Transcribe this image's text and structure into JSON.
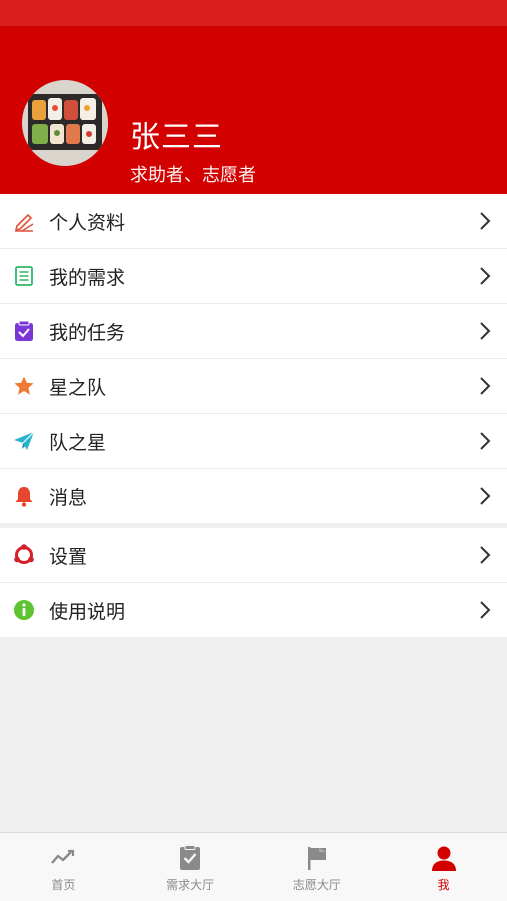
{
  "profile": {
    "name": "张三三",
    "roles": "求助者、志愿者"
  },
  "menu": {
    "items": [
      {
        "label": "个人资料",
        "icon": "pencil-icon",
        "color": "#e0523c"
      },
      {
        "label": "我的需求",
        "icon": "list-icon",
        "color": "#2fb86b"
      },
      {
        "label": "我的任务",
        "icon": "task-check-icon",
        "color": "#7b35d6"
      },
      {
        "label": "星之队",
        "icon": "star-icon",
        "color": "#f07a35"
      },
      {
        "label": "队之星",
        "icon": "paper-plane-icon",
        "color": "#26b5cf"
      },
      {
        "label": "消息",
        "icon": "bell-icon",
        "color": "#e8452f"
      }
    ],
    "secondary": [
      {
        "label": "设置",
        "icon": "settings-icon",
        "color": "#d61d2a"
      },
      {
        "label": "使用说明",
        "icon": "info-icon",
        "color": "#5fc431"
      }
    ]
  },
  "tabbar": {
    "tabs": [
      {
        "label": "首页",
        "icon": "trend-icon"
      },
      {
        "label": "需求大厅",
        "icon": "clipboard-check-icon"
      },
      {
        "label": "志愿大厅",
        "icon": "flag-icon"
      },
      {
        "label": "我",
        "icon": "person-icon",
        "active": true
      }
    ]
  },
  "colors": {
    "brand": "#d30000",
    "inactive_tab": "#8a8a8a"
  }
}
